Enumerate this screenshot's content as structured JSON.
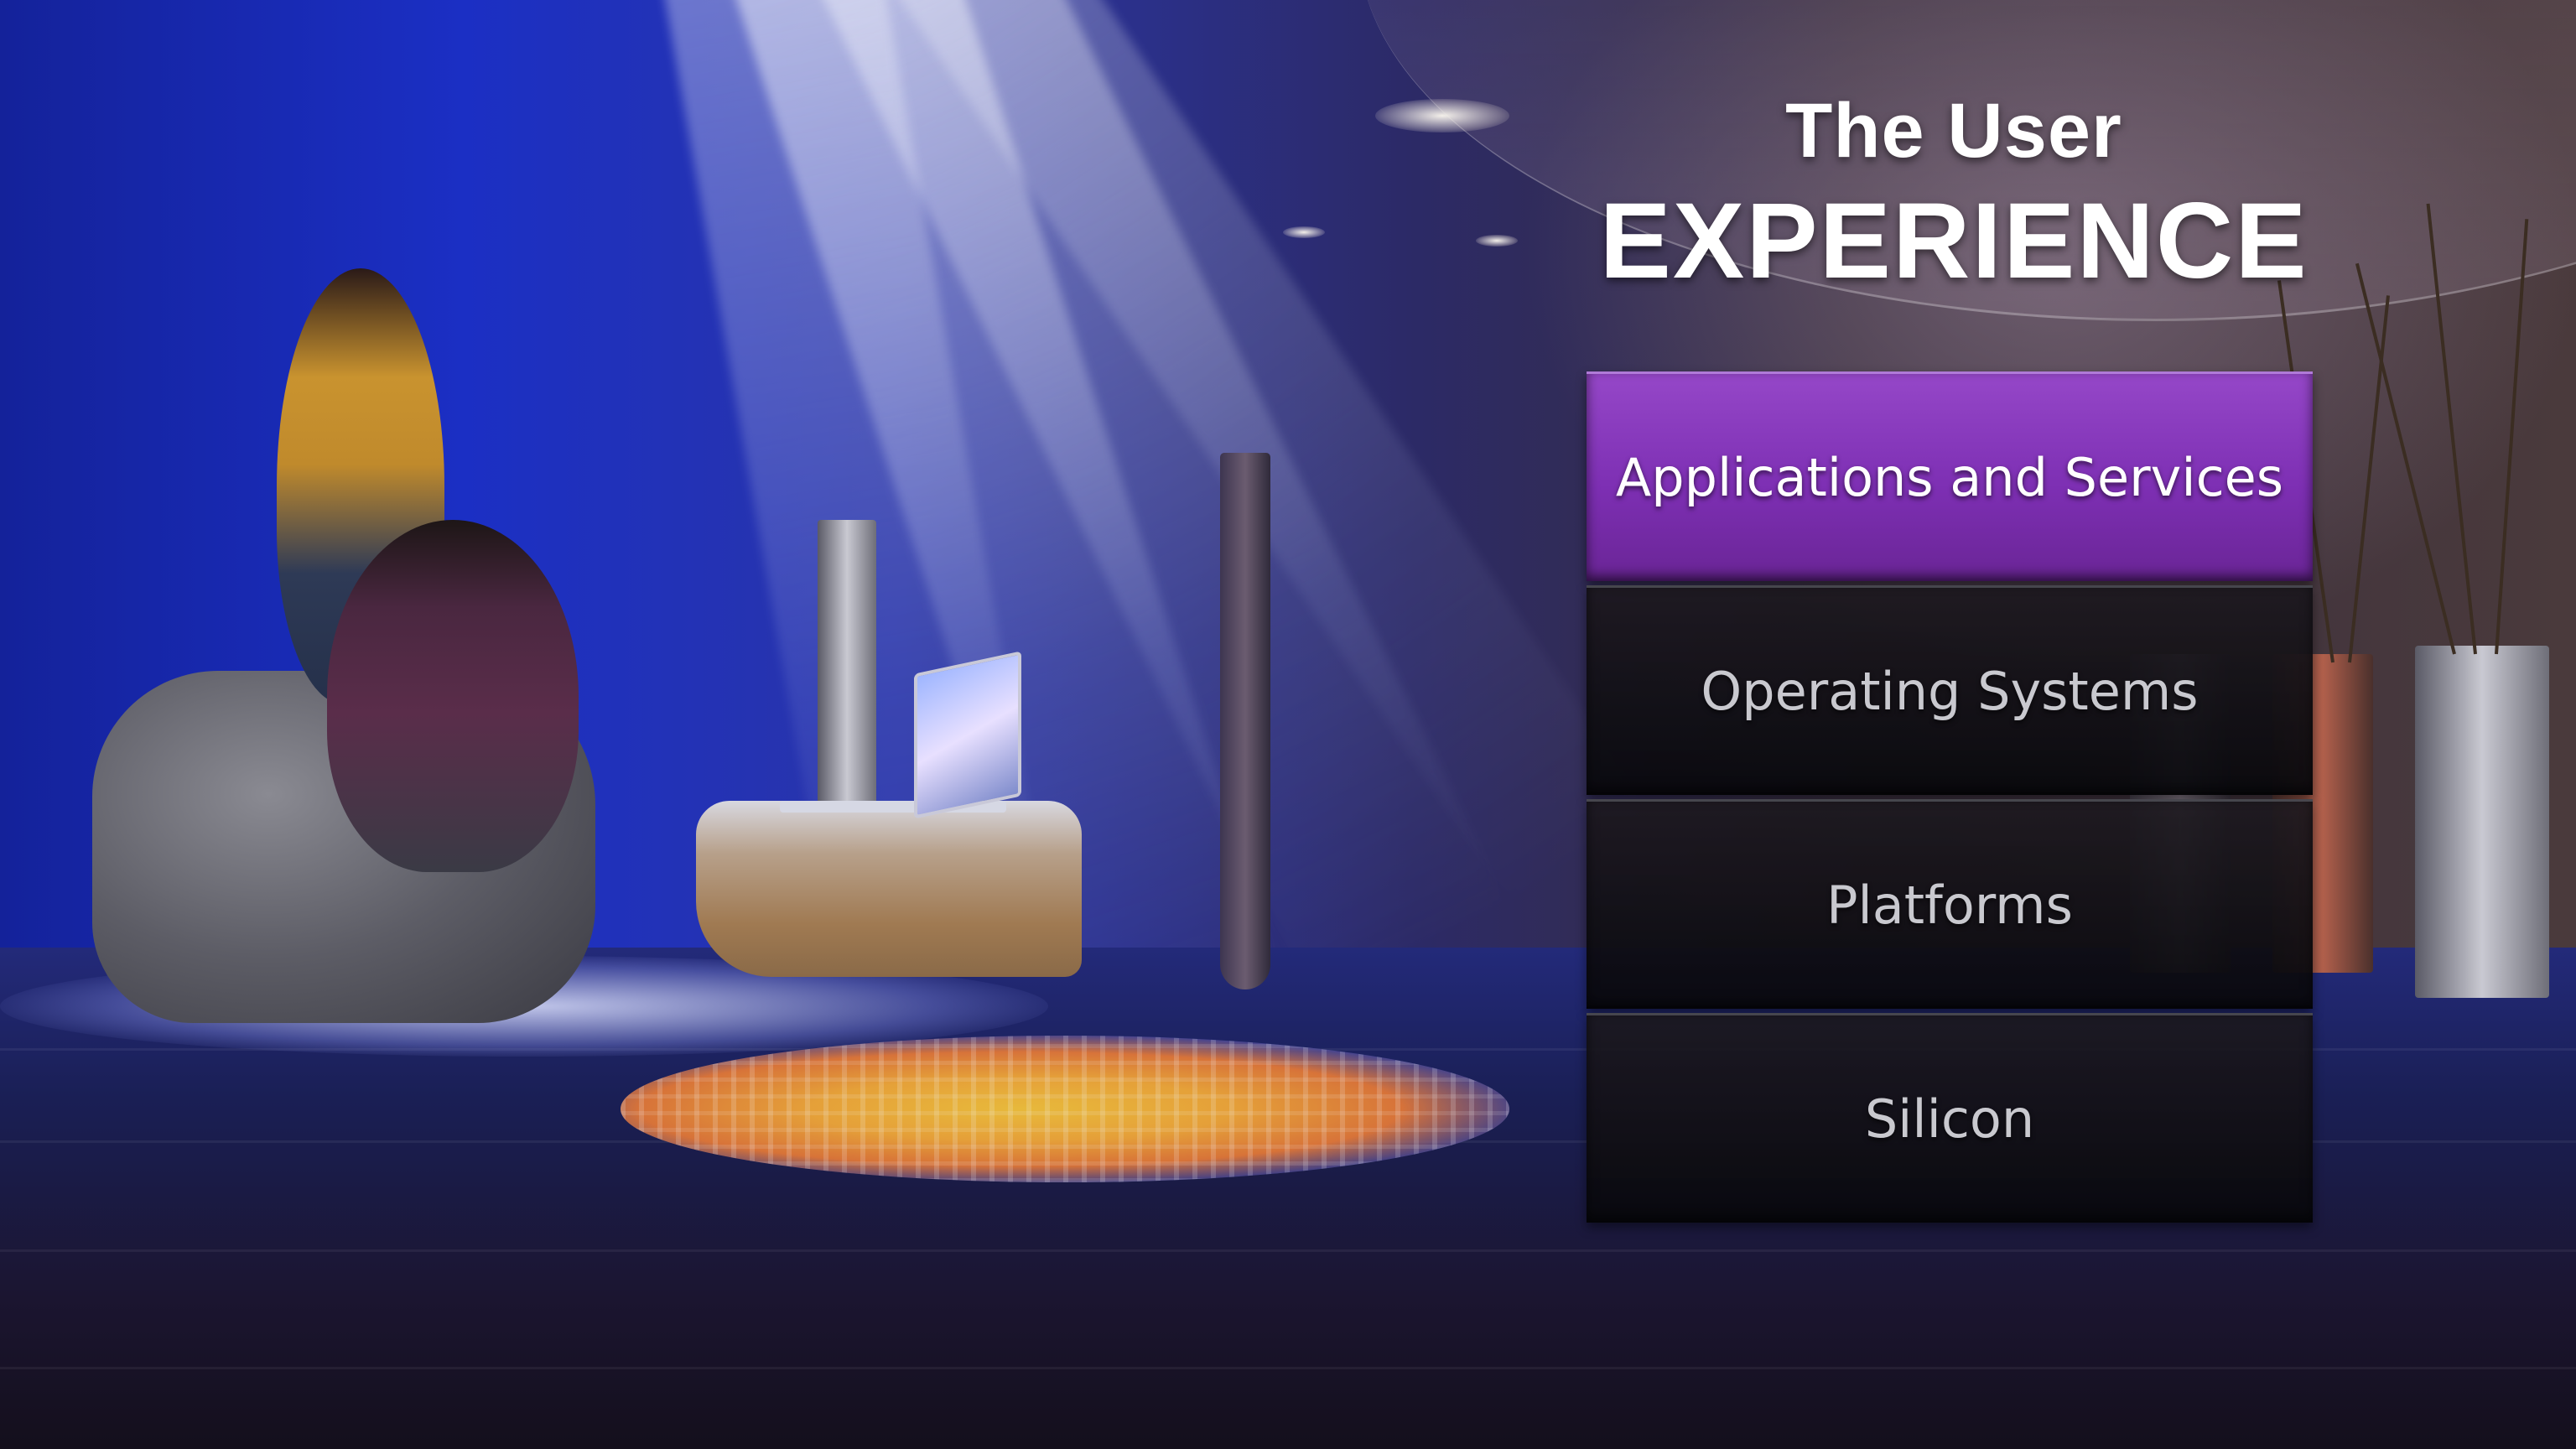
{
  "title": {
    "line1": "The User",
    "line2": "EXPERIENCE"
  },
  "menu": {
    "items": [
      {
        "label": "Applications and Services",
        "active": true
      },
      {
        "label": "Operating Systems",
        "active": false
      },
      {
        "label": "Platforms",
        "active": false
      },
      {
        "label": "Silicon",
        "active": false
      }
    ]
  },
  "colors": {
    "active_item": "#7d2fb3",
    "inactive_item": "#0f0d12",
    "title_text": "#ffffff"
  }
}
